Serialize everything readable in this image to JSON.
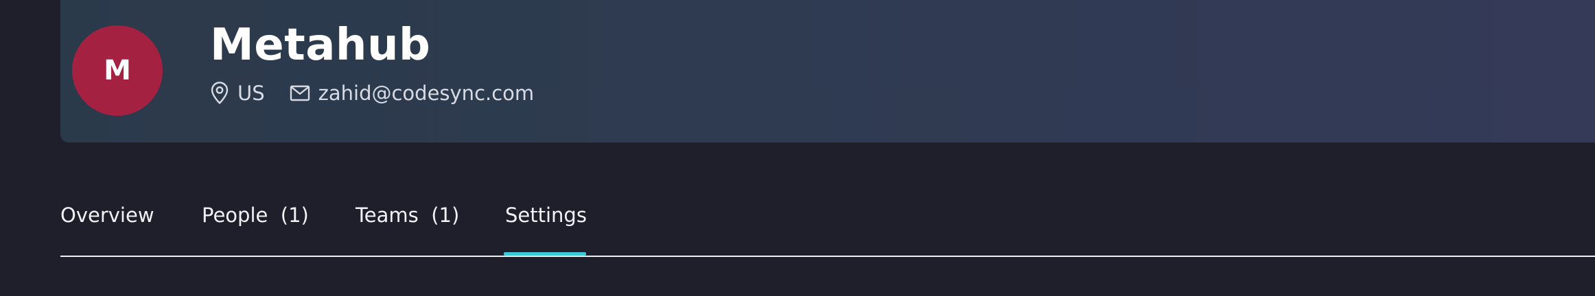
{
  "org": {
    "avatar_letter": "M",
    "name": "Metahub",
    "location": "US",
    "email": "zahid@codesync.com",
    "avatar_color": "#a52141"
  },
  "icons": {
    "location": "location-pin-icon",
    "email": "mail-icon"
  },
  "tabs": [
    {
      "label": "Overview",
      "active": false
    },
    {
      "label": "People  (1)",
      "active": false
    },
    {
      "label": "Teams  (1)",
      "active": false
    },
    {
      "label": "Settings",
      "active": true
    }
  ],
  "colors": {
    "background": "#1f1f2b",
    "accent": "#3ec8d7",
    "text": "#ffffff"
  }
}
